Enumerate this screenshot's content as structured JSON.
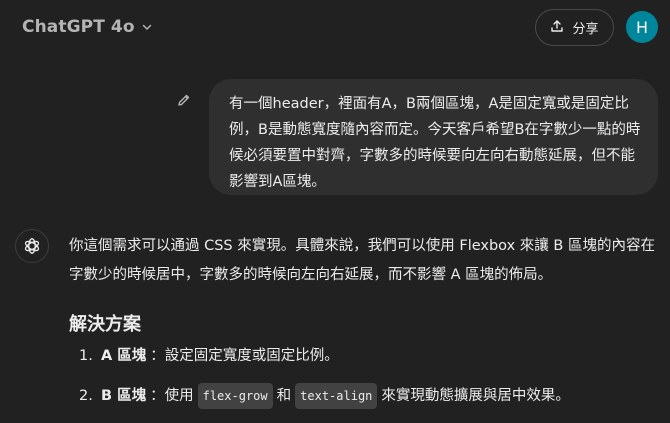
{
  "header": {
    "model_name": "ChatGPT 4o",
    "share_label": "分享",
    "avatar_initial": "H"
  },
  "user_message": {
    "text": "有一個header，裡面有A，B兩個區塊，A是固定寬或是固定比例，B是動態寬度隨內容而定。今天客戶希望B在字數少一點的時候必須要置中對齊，字數多的時候要向左向右動態延展，但不能影響到A區塊。"
  },
  "assistant_message": {
    "intro": "你這個需求可以通過 CSS 來實現。具體來說，我們可以使用 Flexbox 來讓 B 區塊的內容在字數少的時候居中，字數多的時候向左向右延展，而不影響 A 區塊的佈局。",
    "heading": "解決方案",
    "items": [
      {
        "number": "1.",
        "term": "A 區塊",
        "sep": "：",
        "text": "設定固定寬度或固定比例。"
      },
      {
        "number": "2.",
        "term": "B 區塊",
        "sep": "：",
        "pre": "使用",
        "code1": "flex-grow",
        "mid": "和",
        "code2": "text-align",
        "post": "來實現動態擴展與居中效果。"
      }
    ]
  },
  "colors": {
    "background": "#212121",
    "bubble": "#2f2f2f",
    "avatar": "#00869b",
    "text": "#ececec",
    "muted": "#b4b4b4"
  },
  "icons": {
    "model_dropdown": "chevron-down-icon",
    "share": "share-upload-icon",
    "edit": "pencil-icon",
    "assistant": "openai-logo-icon"
  }
}
